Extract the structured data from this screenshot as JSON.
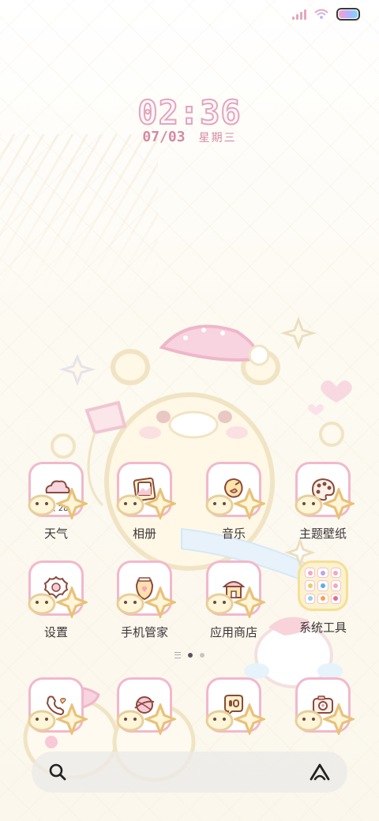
{
  "status_bar": {
    "signal_icon": "signal-bars-icon",
    "wifi_icon": "wifi-icon",
    "battery_icon": "battery-icon"
  },
  "clock": {
    "time": "02:36",
    "date": "07/03",
    "weekday": "星期三"
  },
  "apps": [
    {
      "label": "天气",
      "icon": "weather-cloud-icon",
      "overlay": "多云 28°"
    },
    {
      "label": "相册",
      "icon": "photo-album-icon"
    },
    {
      "label": "音乐",
      "icon": "music-note-icon"
    },
    {
      "label": "主题壁纸",
      "icon": "palette-icon"
    },
    {
      "label": "设置",
      "icon": "gear-flower-icon"
    },
    {
      "label": "手机管家",
      "icon": "shield-jar-icon"
    },
    {
      "label": "应用商店",
      "icon": "store-house-icon"
    },
    {
      "label": "系统工具",
      "icon": "folder-icon"
    }
  ],
  "dock": [
    {
      "icon": "phone-icon"
    },
    {
      "icon": "browser-planet-icon"
    },
    {
      "icon": "message-bubble-icon"
    },
    {
      "icon": "camera-icon"
    }
  ],
  "page_indicator": {
    "pages": 2,
    "active": 1
  },
  "search": {
    "search_icon": "search-icon",
    "assistant_icon": "assistant-icon"
  },
  "colors": {
    "accent_pink": "#f2b8cb",
    "text": "#3c3538",
    "clock_stroke": "#e2a6bc"
  }
}
